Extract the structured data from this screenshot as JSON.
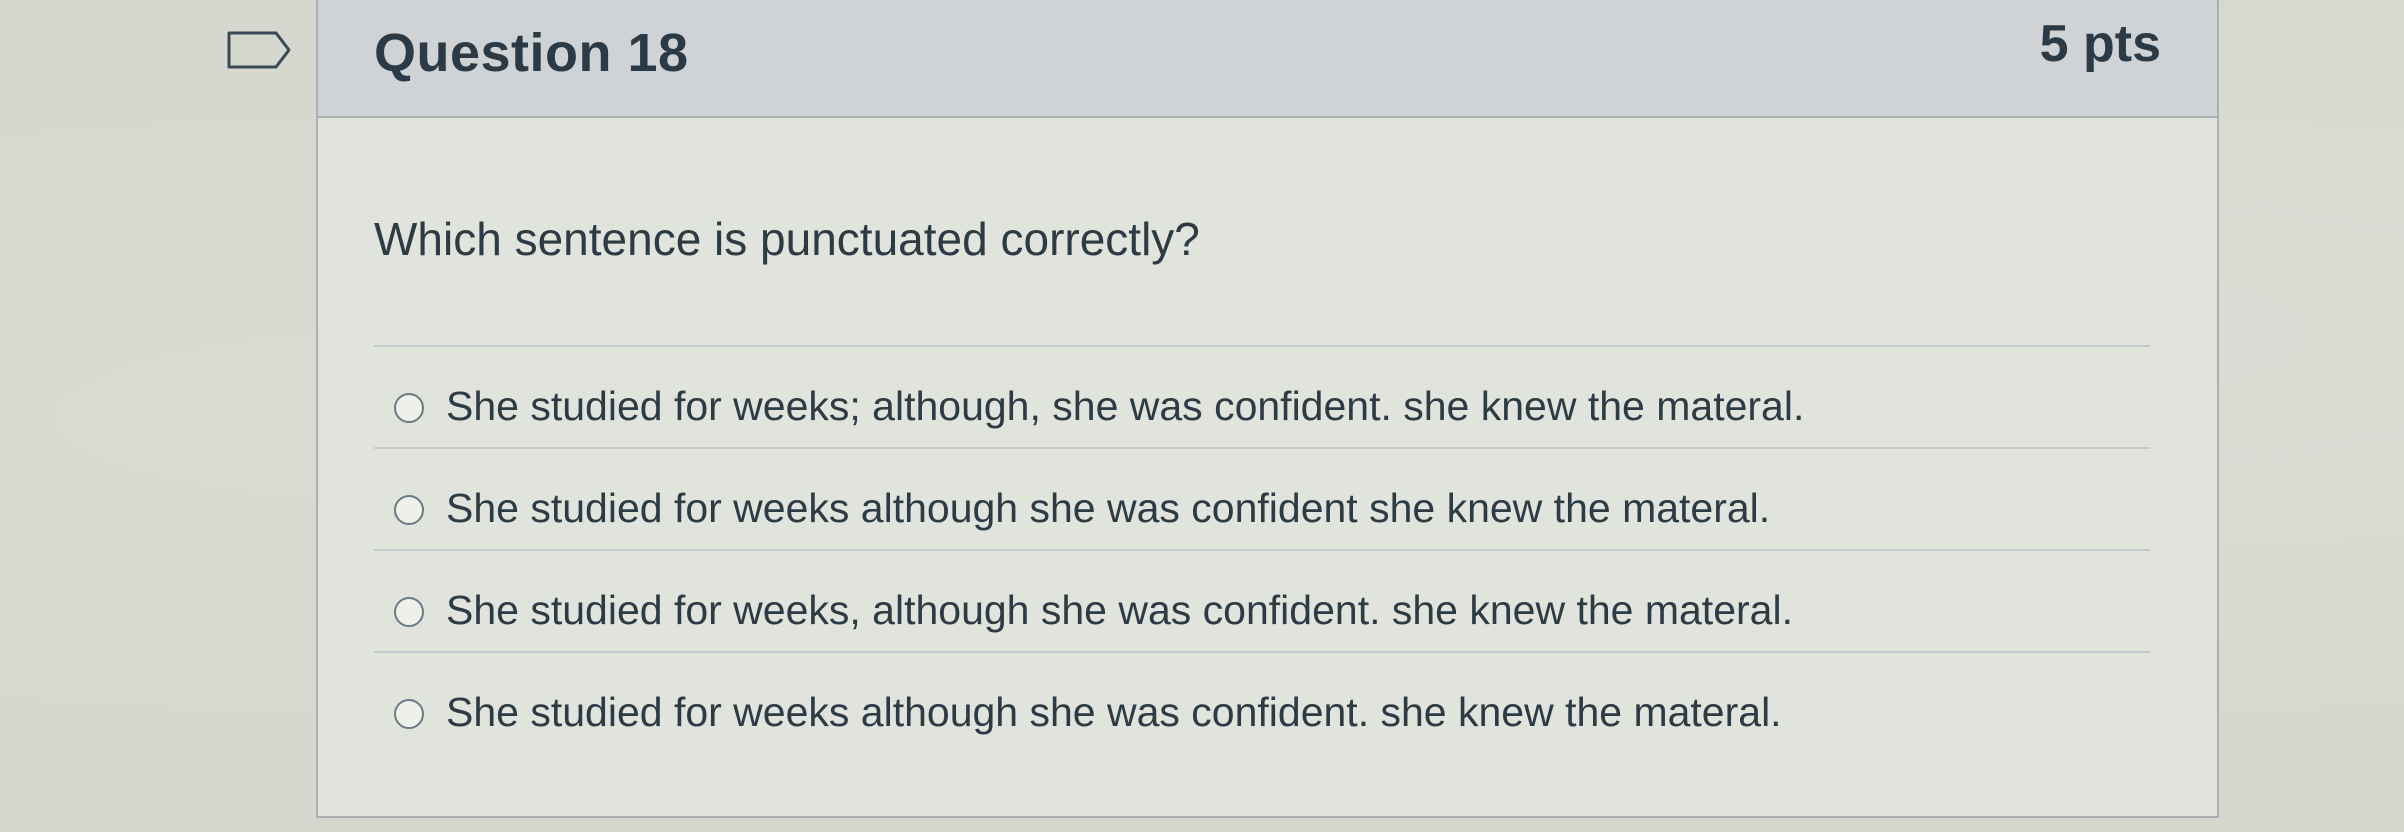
{
  "question": {
    "title": "Question 18",
    "points": "5 pts",
    "text": "Which sentence is punctuated correctly?",
    "flag_icon": "flag-icon",
    "answers": [
      {
        "label": "She studied for weeks; although, she was confident. she knew the materal."
      },
      {
        "label": "She studied for weeks although she was confident she knew the materal."
      },
      {
        "label": "She studied for weeks, although she was confident. she knew the materal."
      },
      {
        "label": "She studied for weeks although she was confident. she knew the materal."
      }
    ]
  }
}
